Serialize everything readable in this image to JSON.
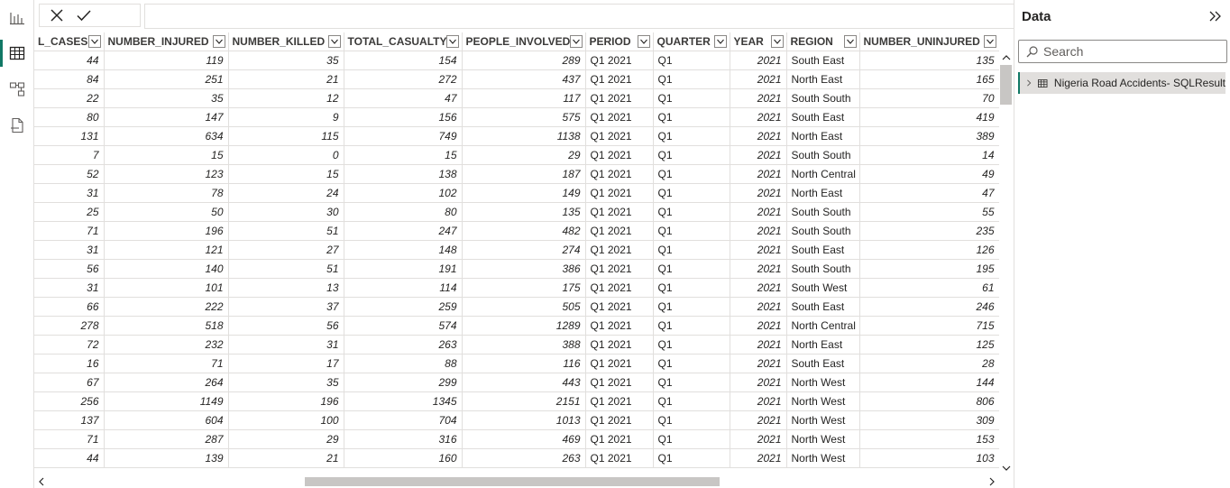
{
  "formula_bar": {
    "value": ""
  },
  "columns": [
    {
      "label": "L_CASES",
      "width": 77,
      "type": "num"
    },
    {
      "label": "NUMBER_INJURED",
      "width": 138,
      "type": "num"
    },
    {
      "label": "NUMBER_KILLED",
      "width": 128,
      "type": "num"
    },
    {
      "label": "TOTAL_CASUALTY",
      "width": 131,
      "type": "num"
    },
    {
      "label": "PEOPLE_INVOLVED",
      "width": 137,
      "type": "num"
    },
    {
      "label": "PERIOD",
      "width": 75,
      "type": "txt"
    },
    {
      "label": "QUARTER",
      "width": 85,
      "type": "txt"
    },
    {
      "label": "YEAR",
      "width": 63,
      "type": "num"
    },
    {
      "label": "REGION",
      "width": 81,
      "type": "txt"
    },
    {
      "label": "NUMBER_UNINJURED",
      "width": 155,
      "type": "num"
    }
  ],
  "rows": [
    [
      "44",
      "119",
      "35",
      "154",
      "289",
      "Q1 2021",
      "Q1",
      "2021",
      "South East",
      "135"
    ],
    [
      "84",
      "251",
      "21",
      "272",
      "437",
      "Q1 2021",
      "Q1",
      "2021",
      "North East",
      "165"
    ],
    [
      "22",
      "35",
      "12",
      "47",
      "117",
      "Q1 2021",
      "Q1",
      "2021",
      "South South",
      "70"
    ],
    [
      "80",
      "147",
      "9",
      "156",
      "575",
      "Q1 2021",
      "Q1",
      "2021",
      "South East",
      "419"
    ],
    [
      "131",
      "634",
      "115",
      "749",
      "1138",
      "Q1 2021",
      "Q1",
      "2021",
      "North East",
      "389"
    ],
    [
      "7",
      "15",
      "0",
      "15",
      "29",
      "Q1 2021",
      "Q1",
      "2021",
      "South South",
      "14"
    ],
    [
      "52",
      "123",
      "15",
      "138",
      "187",
      "Q1 2021",
      "Q1",
      "2021",
      "North Central",
      "49"
    ],
    [
      "31",
      "78",
      "24",
      "102",
      "149",
      "Q1 2021",
      "Q1",
      "2021",
      "North East",
      "47"
    ],
    [
      "25",
      "50",
      "30",
      "80",
      "135",
      "Q1 2021",
      "Q1",
      "2021",
      "South South",
      "55"
    ],
    [
      "71",
      "196",
      "51",
      "247",
      "482",
      "Q1 2021",
      "Q1",
      "2021",
      "South South",
      "235"
    ],
    [
      "31",
      "121",
      "27",
      "148",
      "274",
      "Q1 2021",
      "Q1",
      "2021",
      "South East",
      "126"
    ],
    [
      "56",
      "140",
      "51",
      "191",
      "386",
      "Q1 2021",
      "Q1",
      "2021",
      "South South",
      "195"
    ],
    [
      "31",
      "101",
      "13",
      "114",
      "175",
      "Q1 2021",
      "Q1",
      "2021",
      "South West",
      "61"
    ],
    [
      "66",
      "222",
      "37",
      "259",
      "505",
      "Q1 2021",
      "Q1",
      "2021",
      "South East",
      "246"
    ],
    [
      "278",
      "518",
      "56",
      "574",
      "1289",
      "Q1 2021",
      "Q1",
      "2021",
      "North Central",
      "715"
    ],
    [
      "72",
      "232",
      "31",
      "263",
      "388",
      "Q1 2021",
      "Q1",
      "2021",
      "North East",
      "125"
    ],
    [
      "16",
      "71",
      "17",
      "88",
      "116",
      "Q1 2021",
      "Q1",
      "2021",
      "South East",
      "28"
    ],
    [
      "67",
      "264",
      "35",
      "299",
      "443",
      "Q1 2021",
      "Q1",
      "2021",
      "North West",
      "144"
    ],
    [
      "256",
      "1149",
      "196",
      "1345",
      "2151",
      "Q1 2021",
      "Q1",
      "2021",
      "North West",
      "806"
    ],
    [
      "137",
      "604",
      "100",
      "704",
      "1013",
      "Q1 2021",
      "Q1",
      "2021",
      "North West",
      "309"
    ],
    [
      "71",
      "287",
      "29",
      "316",
      "469",
      "Q1 2021",
      "Q1",
      "2021",
      "North West",
      "153"
    ],
    [
      "44",
      "139",
      "21",
      "160",
      "263",
      "Q1 2021",
      "Q1",
      "2021",
      "North West",
      "103"
    ]
  ],
  "data_pane": {
    "title": "Data",
    "search_placeholder": "Search",
    "table_name": "Nigeria Road Accidents- SQLResult"
  },
  "icons": {
    "rail": [
      "report-view-icon",
      "table-view-icon",
      "model-view-icon",
      "dax-query-icon"
    ],
    "accent_color": "#117865"
  }
}
